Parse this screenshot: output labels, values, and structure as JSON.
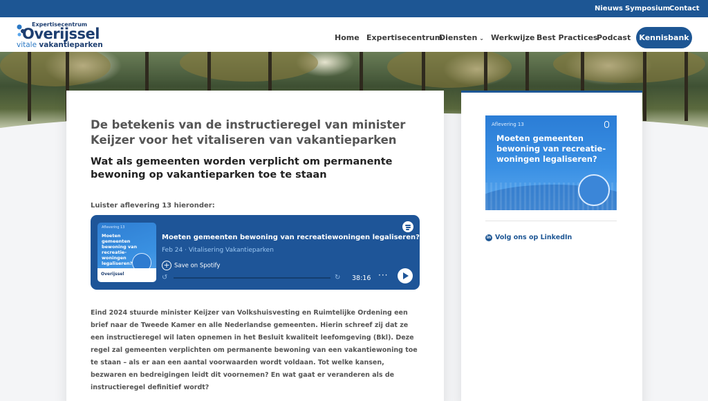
{
  "topbar": {
    "links": [
      "Nieuws",
      "Symposium",
      "Contact"
    ]
  },
  "logo": {
    "line1": "Expertisecentrum",
    "line2": "Overijssel",
    "line3a": "vitale ",
    "line3b": "vakantieparken"
  },
  "nav": {
    "items": [
      "Home",
      "Expertisecentrum",
      "Diensten",
      "Werkwijze",
      "Best Practices",
      "Podcast"
    ],
    "dropdown_icon": "chevron-down-icon",
    "cta": "Kennisbank"
  },
  "article": {
    "title": "De betekenis van de instructieregel van minister Keijzer voor het vitaliseren van vakantieparken",
    "subtitle": "Wat als gemeenten worden verplicht om permanente bewoning op vakantieparken toe te staan",
    "listen_label": "Luister aflevering 13 hieronder:",
    "body": "Eind 2024 stuurde minister Keijzer van Volkshuisvesting en Ruimtelijke Ordening een brief naar de Tweede Kamer en alle Nederlandse gemeenten. Hierin schreef zij dat ze een instructieregel wil laten opnemen in het Besluit kwaliteit leefomgeving (Bkl). Deze regel zal gemeenten verplichten om permanente bewoning van een vakantiewoning toe te staan – als er aan een aantal voorwaarden wordt voldaan. Tot welke kansen, bezwaren en bedreigingen leidt dit voornemen? En wat gaat er veranderen als de instructieregel definitief wordt?"
  },
  "player": {
    "thumb_episode": "Aflevering 13",
    "thumb_title": "Moeten gemeenten bewoning van recreatie-woningen legaliseren?",
    "thumb_logo": "Overijssel",
    "title": "Moeten gemeenten bewoning van recreatiewoningen legaliseren?",
    "meta": "Feb 24 · Vitalisering Vakantieparken",
    "save_label": "Save on Spotify",
    "duration": "38:16",
    "progress": 0,
    "accent": "#1e5598"
  },
  "sidebar": {
    "promo_episode": "Aflevering 13",
    "promo_title": "Moeten gemeenten bewoning van recreatie-woningen legaliseren?",
    "linkedin_label": "Volg ons op LinkedIn"
  },
  "colors": {
    "brand": "#1d5694",
    "text": "#555555"
  }
}
